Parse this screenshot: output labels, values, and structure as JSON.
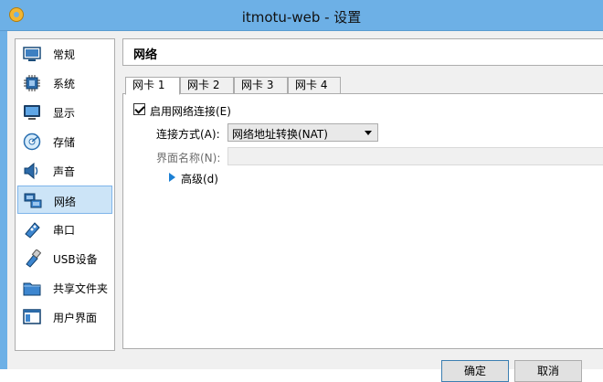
{
  "window": {
    "title": "itmotu-web - 设置"
  },
  "sidebar": {
    "items": [
      {
        "label": "常规",
        "icon": "general-icon",
        "selected": false
      },
      {
        "label": "系统",
        "icon": "system-chip-icon",
        "selected": false
      },
      {
        "label": "显示",
        "icon": "display-monitor-icon",
        "selected": false
      },
      {
        "label": "存储",
        "icon": "storage-disk-icon",
        "selected": false
      },
      {
        "label": "声音",
        "icon": "audio-speaker-icon",
        "selected": false
      },
      {
        "label": "网络",
        "icon": "network-icon",
        "selected": true
      },
      {
        "label": "串口",
        "icon": "serial-port-icon",
        "selected": false
      },
      {
        "label": "USB设备",
        "icon": "usb-icon",
        "selected": false
      },
      {
        "label": "共享文件夹",
        "icon": "shared-folder-icon",
        "selected": false
      },
      {
        "label": "用户界面",
        "icon": "user-interface-icon",
        "selected": false
      }
    ]
  },
  "page": {
    "title": "网络"
  },
  "tabs": [
    {
      "label": "网卡 1",
      "active": true
    },
    {
      "label": "网卡 2",
      "active": false
    },
    {
      "label": "网卡 3",
      "active": false
    },
    {
      "label": "网卡 4",
      "active": false
    }
  ],
  "adapter": {
    "enable_label": "启用网络连接(E)",
    "enabled": true,
    "attached_label": "连接方式(A):",
    "attached_value": "网络地址转换(NAT)",
    "name_label": "界面名称(N):",
    "name_value": "",
    "advanced_label": "高级(d)"
  },
  "buttons": {
    "ok": "确定",
    "cancel": "取消"
  },
  "colors": {
    "titlebar": "#6db0e6",
    "selection": "#cce4f7",
    "selection_border": "#7eb4ea",
    "disabled_text": "#6d6d6d"
  }
}
